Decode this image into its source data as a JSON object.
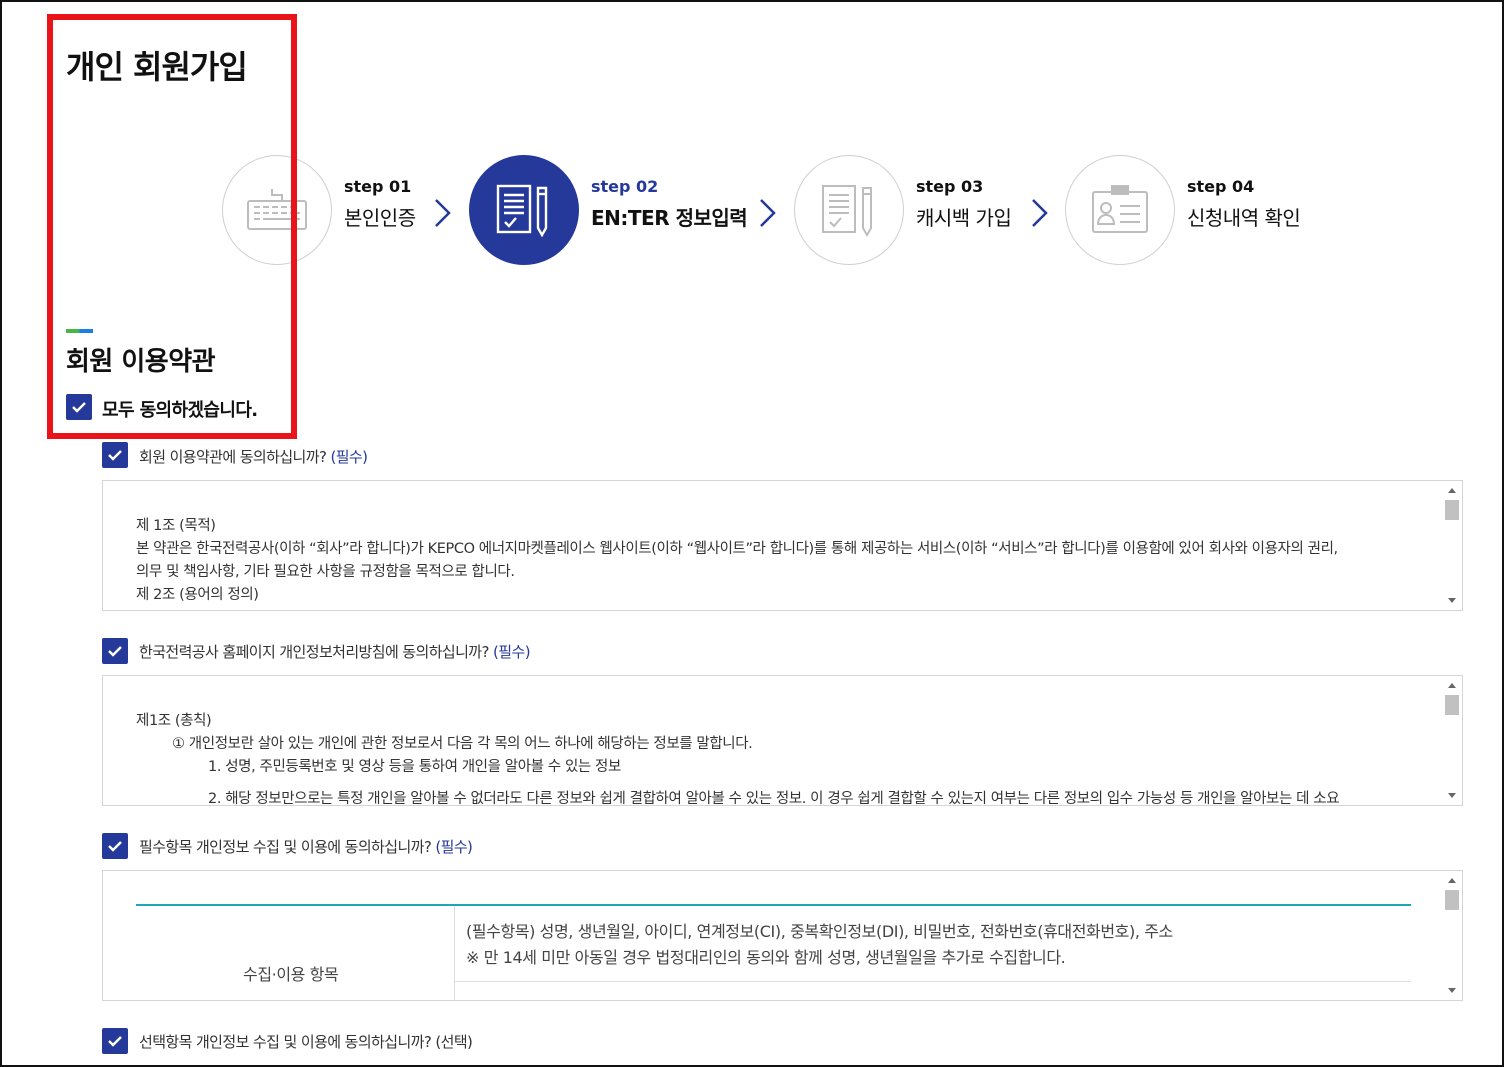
{
  "page": {
    "title": "개인 회원가입"
  },
  "steps": [
    {
      "num": "step 01",
      "name": "본인인증",
      "icon": "keyboard-icon",
      "active": false
    },
    {
      "num": "step 02",
      "name": "EN:TER 정보입력",
      "icon": "form-pen-icon",
      "active": true
    },
    {
      "num": "step 03",
      "name": "캐시백 가입",
      "icon": "form-pen-icon",
      "active": false
    },
    {
      "num": "step 04",
      "name": "신청내역 확인",
      "icon": "id-card-icon",
      "active": false
    }
  ],
  "section": {
    "title": "회원 이용약관"
  },
  "agree_all": {
    "label": "모두 동의하겠습니다.",
    "checked": true
  },
  "agreements": [
    {
      "label": "회원 이용약관에 동의하십니까?",
      "tag": "(필수)",
      "checked": true,
      "lines": [
        "제 1조 (목적)",
        "본 약관은 한국전력공사(이하 “회사”라 합니다)가 KEPCO 에너지마켓플레이스 웹사이트(이하 “웹사이트”라 합니다)를 통해 제공하는 서비스(이하 “서비스”라 합니다)를 이용함에 있어 회사와 이용자의 권리,",
        "의무 및 책임사항, 기타 필요한 사항을 규정함을 목적으로 합니다.",
        "제 2조 (용어의 정의)"
      ]
    },
    {
      "label": "한국전력공사 홈페이지 개인정보처리방침에 동의하십니까?",
      "tag": "(필수)",
      "checked": true,
      "lines": [
        "제1조  (총칙)",
        "① 개인정보란 살아 있는 개인에 관한 정보로서 다음 각 목의 어느 하나에 해당하는 정보를 말합니다.",
        "1. 성명, 주민등록번호 및 영상 등을 통하여 개인을 알아볼 수 있는 정보",
        "2. 해당 정보만으로는 특정 개인을 알아볼 수 없더라도 다른 정보와 쉽게 결합하여 알아볼 수 있는 정보. 이 경우 쉽게 결합할 수 있는지 여부는 다른 정보의 입수 가능성 등 개인을 알아보는 데 소요"
      ]
    },
    {
      "label": "필수항목 개인정보 수집 및 이용에 동의하십니까?",
      "tag": "(필수)",
      "checked": true,
      "table": {
        "head": "수집·이용 항목",
        "cell_line1": "(필수항목) 성명, 생년월일, 아이디, 연계정보(CI), 중복확인정보(DI), 비밀번호, 전화번호(휴대전화번호), 주소",
        "cell_line2": "※ 만 14세 미만 아동일 경우 법정대리인의 동의와 함께 성명, 생년월일을 추가로 수집합니다."
      }
    },
    {
      "label": "선택항목 개인정보 수집 및 이용에 동의하십니까?",
      "tag": "(선택)",
      "checked": true
    }
  ],
  "colors": {
    "primary": "#24399a",
    "highlight": "#e8141a",
    "table_accent": "#1fa5b5"
  }
}
